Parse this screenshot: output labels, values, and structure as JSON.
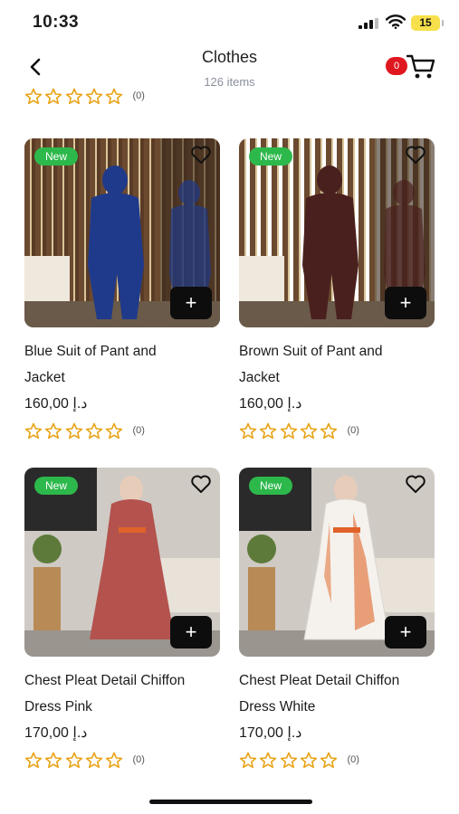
{
  "status_bar": {
    "time": "10:33",
    "battery": "15"
  },
  "header": {
    "title": "Clothes",
    "subtitle": "126 items",
    "cart_count": "0"
  },
  "partial_rating": {
    "count": "(0)",
    "stars": 0
  },
  "products": [
    {
      "badge": "New",
      "name_line1": "Blue Suit of Pant and",
      "name_line2": "Jacket",
      "price": "160,00 د.إ",
      "rating_count": "(0)",
      "stars": 0,
      "garment_color": "#1f3a8a",
      "add_label": "+"
    },
    {
      "badge": "New",
      "name_line1": "Brown Suit of Pant and",
      "name_line2": "Jacket",
      "price": "160,00 د.إ",
      "rating_count": "(0)",
      "stars": 0,
      "garment_color": "#4a201e",
      "add_label": "+"
    },
    {
      "badge": "New",
      "name_line1": "Chest Pleat Detail Chiffon",
      "name_line2": "Dress Pink",
      "price": "170,00 د.إ",
      "rating_count": "(0)",
      "stars": 0,
      "garment_color": "#b4524e",
      "add_label": "+"
    },
    {
      "badge": "New",
      "name_line1": "Chest Pleat Detail Chiffon",
      "name_line2": "Dress White",
      "price": "170,00 د.إ",
      "rating_count": "(0)",
      "stars": 0,
      "garment_color": "#f5f2ee",
      "add_label": "+"
    }
  ],
  "colors": {
    "new_badge": "#2db84b",
    "cart_badge": "#e0171f",
    "star_outline": "#e8a317",
    "add_button": "#0d0d0d"
  },
  "icons": {
    "back": "chevron-left-icon",
    "cart": "cart-icon",
    "favorite": "heart-outline-icon",
    "star": "star-outline-icon",
    "add": "plus-icon"
  }
}
